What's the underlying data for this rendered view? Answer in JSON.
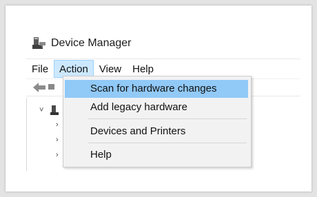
{
  "window": {
    "title": "Device Manager"
  },
  "menubar": {
    "items": [
      {
        "label": "File"
      },
      {
        "label": "Action"
      },
      {
        "label": "View"
      },
      {
        "label": "Help"
      }
    ]
  },
  "action_menu": {
    "items": [
      {
        "label": "Scan for hardware changes"
      },
      {
        "label": "Add legacy hardware"
      },
      {
        "label": "Devices and Printers"
      },
      {
        "label": "Help"
      }
    ]
  },
  "tree": {
    "root_expander": "˅",
    "child_expander": "›"
  },
  "colors": {
    "menu_highlight": "#91c9f7",
    "menubar_active": "#cce8ff",
    "menu_background": "#f2f2f2"
  }
}
